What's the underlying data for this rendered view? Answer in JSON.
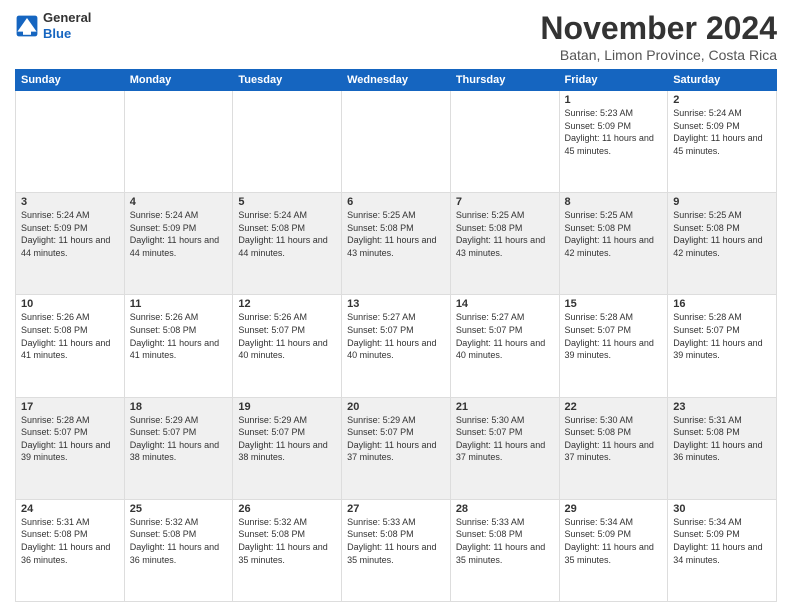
{
  "header": {
    "logo": {
      "general": "General",
      "blue": "Blue"
    },
    "title": "November 2024",
    "location": "Batan, Limon Province, Costa Rica"
  },
  "calendar": {
    "days_of_week": [
      "Sunday",
      "Monday",
      "Tuesday",
      "Wednesday",
      "Thursday",
      "Friday",
      "Saturday"
    ],
    "weeks": [
      [
        {
          "day": "",
          "info": ""
        },
        {
          "day": "",
          "info": ""
        },
        {
          "day": "",
          "info": ""
        },
        {
          "day": "",
          "info": ""
        },
        {
          "day": "",
          "info": ""
        },
        {
          "day": "1",
          "info": "Sunrise: 5:23 AM\nSunset: 5:09 PM\nDaylight: 11 hours and 45 minutes."
        },
        {
          "day": "2",
          "info": "Sunrise: 5:24 AM\nSunset: 5:09 PM\nDaylight: 11 hours and 45 minutes."
        }
      ],
      [
        {
          "day": "3",
          "info": "Sunrise: 5:24 AM\nSunset: 5:09 PM\nDaylight: 11 hours and 44 minutes."
        },
        {
          "day": "4",
          "info": "Sunrise: 5:24 AM\nSunset: 5:09 PM\nDaylight: 11 hours and 44 minutes."
        },
        {
          "day": "5",
          "info": "Sunrise: 5:24 AM\nSunset: 5:08 PM\nDaylight: 11 hours and 44 minutes."
        },
        {
          "day": "6",
          "info": "Sunrise: 5:25 AM\nSunset: 5:08 PM\nDaylight: 11 hours and 43 minutes."
        },
        {
          "day": "7",
          "info": "Sunrise: 5:25 AM\nSunset: 5:08 PM\nDaylight: 11 hours and 43 minutes."
        },
        {
          "day": "8",
          "info": "Sunrise: 5:25 AM\nSunset: 5:08 PM\nDaylight: 11 hours and 42 minutes."
        },
        {
          "day": "9",
          "info": "Sunrise: 5:25 AM\nSunset: 5:08 PM\nDaylight: 11 hours and 42 minutes."
        }
      ],
      [
        {
          "day": "10",
          "info": "Sunrise: 5:26 AM\nSunset: 5:08 PM\nDaylight: 11 hours and 41 minutes."
        },
        {
          "day": "11",
          "info": "Sunrise: 5:26 AM\nSunset: 5:08 PM\nDaylight: 11 hours and 41 minutes."
        },
        {
          "day": "12",
          "info": "Sunrise: 5:26 AM\nSunset: 5:07 PM\nDaylight: 11 hours and 40 minutes."
        },
        {
          "day": "13",
          "info": "Sunrise: 5:27 AM\nSunset: 5:07 PM\nDaylight: 11 hours and 40 minutes."
        },
        {
          "day": "14",
          "info": "Sunrise: 5:27 AM\nSunset: 5:07 PM\nDaylight: 11 hours and 40 minutes."
        },
        {
          "day": "15",
          "info": "Sunrise: 5:28 AM\nSunset: 5:07 PM\nDaylight: 11 hours and 39 minutes."
        },
        {
          "day": "16",
          "info": "Sunrise: 5:28 AM\nSunset: 5:07 PM\nDaylight: 11 hours and 39 minutes."
        }
      ],
      [
        {
          "day": "17",
          "info": "Sunrise: 5:28 AM\nSunset: 5:07 PM\nDaylight: 11 hours and 39 minutes."
        },
        {
          "day": "18",
          "info": "Sunrise: 5:29 AM\nSunset: 5:07 PM\nDaylight: 11 hours and 38 minutes."
        },
        {
          "day": "19",
          "info": "Sunrise: 5:29 AM\nSunset: 5:07 PM\nDaylight: 11 hours and 38 minutes."
        },
        {
          "day": "20",
          "info": "Sunrise: 5:29 AM\nSunset: 5:07 PM\nDaylight: 11 hours and 37 minutes."
        },
        {
          "day": "21",
          "info": "Sunrise: 5:30 AM\nSunset: 5:07 PM\nDaylight: 11 hours and 37 minutes."
        },
        {
          "day": "22",
          "info": "Sunrise: 5:30 AM\nSunset: 5:08 PM\nDaylight: 11 hours and 37 minutes."
        },
        {
          "day": "23",
          "info": "Sunrise: 5:31 AM\nSunset: 5:08 PM\nDaylight: 11 hours and 36 minutes."
        }
      ],
      [
        {
          "day": "24",
          "info": "Sunrise: 5:31 AM\nSunset: 5:08 PM\nDaylight: 11 hours and 36 minutes."
        },
        {
          "day": "25",
          "info": "Sunrise: 5:32 AM\nSunset: 5:08 PM\nDaylight: 11 hours and 36 minutes."
        },
        {
          "day": "26",
          "info": "Sunrise: 5:32 AM\nSunset: 5:08 PM\nDaylight: 11 hours and 35 minutes."
        },
        {
          "day": "27",
          "info": "Sunrise: 5:33 AM\nSunset: 5:08 PM\nDaylight: 11 hours and 35 minutes."
        },
        {
          "day": "28",
          "info": "Sunrise: 5:33 AM\nSunset: 5:08 PM\nDaylight: 11 hours and 35 minutes."
        },
        {
          "day": "29",
          "info": "Sunrise: 5:34 AM\nSunset: 5:09 PM\nDaylight: 11 hours and 35 minutes."
        },
        {
          "day": "30",
          "info": "Sunrise: 5:34 AM\nSunset: 5:09 PM\nDaylight: 11 hours and 34 minutes."
        }
      ]
    ]
  }
}
